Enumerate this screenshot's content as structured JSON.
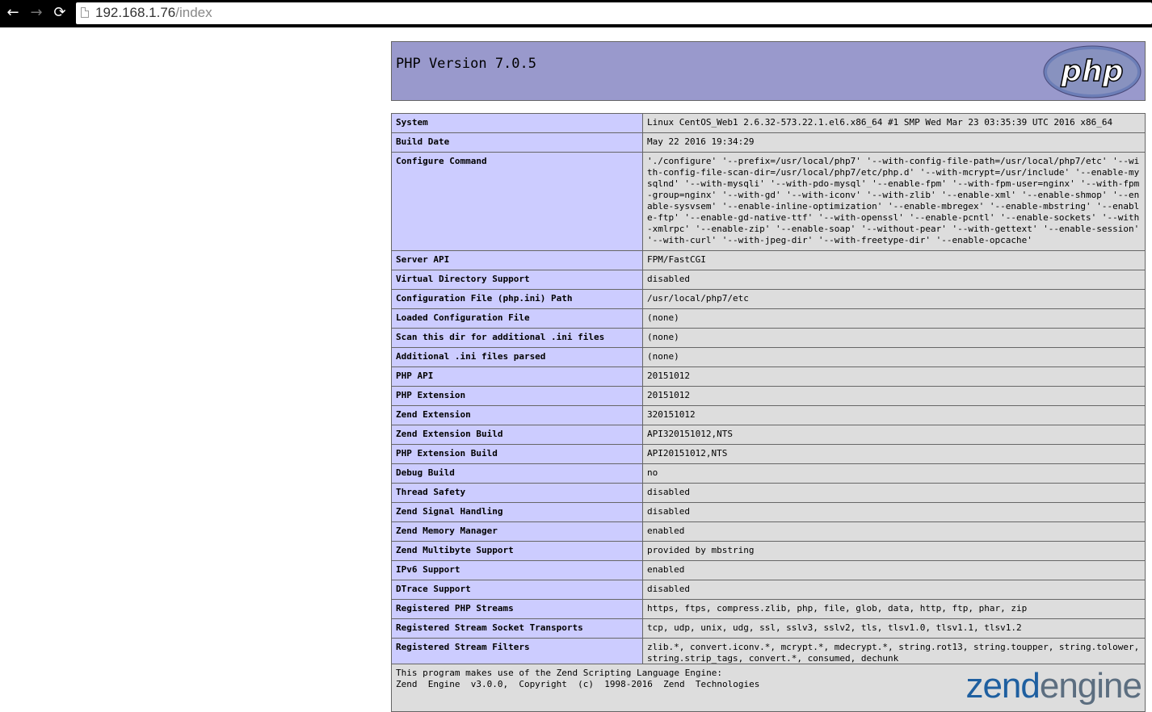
{
  "browser": {
    "url_host": "192.168.1.76",
    "url_path": "/index",
    "back_icon": "←",
    "forward_icon": "→",
    "reload_icon": "⟳"
  },
  "header": {
    "title": "PHP Version 7.0.5",
    "logo_text": "php"
  },
  "rows": [
    {
      "key": "System",
      "value": "Linux CentOS_Web1 2.6.32-573.22.1.el6.x86_64 #1 SMP Wed Mar 23 03:35:39 UTC 2016 x86_64"
    },
    {
      "key": "Build Date",
      "value": "May 22 2016 19:34:29"
    },
    {
      "key": "Configure Command",
      "value": "'./configure' '--prefix=/usr/local/php7' '--with-config-file-path=/usr/local/php7/etc' '--with-config-file-scan-dir=/usr/local/php7/etc/php.d' '--with-mcrypt=/usr/include' '--enable-mysqlnd' '--with-mysqli' '--with-pdo-mysql' '--enable-fpm' '--with-fpm-user=nginx' '--with-fpm-group=nginx' '--with-gd' '--with-iconv' '--with-zlib' '--enable-xml' '--enable-shmop' '--enable-sysvsem' '--enable-inline-optimization' '--enable-mbregex' '--enable-mbstring' '--enable-ftp' '--enable-gd-native-ttf' '--with-openssl' '--enable-pcntl' '--enable-sockets' '--with-xmlrpc' '--enable-zip' '--enable-soap' '--without-pear' '--with-gettext' '--enable-session' '--with-curl' '--with-jpeg-dir' '--with-freetype-dir' '--enable-opcache'"
    },
    {
      "key": "Server API",
      "value": "FPM/FastCGI"
    },
    {
      "key": "Virtual Directory Support",
      "value": "disabled"
    },
    {
      "key": "Configuration File (php.ini) Path",
      "value": "/usr/local/php7/etc"
    },
    {
      "key": "Loaded Configuration File",
      "value": "(none)"
    },
    {
      "key": "Scan this dir for additional .ini files",
      "value": "(none)"
    },
    {
      "key": "Additional .ini files parsed",
      "value": "(none)"
    },
    {
      "key": "PHP API",
      "value": "20151012"
    },
    {
      "key": "PHP Extension",
      "value": "20151012"
    },
    {
      "key": "Zend Extension",
      "value": "320151012"
    },
    {
      "key": "Zend Extension Build",
      "value": "API320151012,NTS"
    },
    {
      "key": "PHP Extension Build",
      "value": "API20151012,NTS"
    },
    {
      "key": "Debug Build",
      "value": "no"
    },
    {
      "key": "Thread Safety",
      "value": "disabled"
    },
    {
      "key": "Zend Signal Handling",
      "value": "disabled"
    },
    {
      "key": "Zend Memory Manager",
      "value": "enabled"
    },
    {
      "key": "Zend Multibyte Support",
      "value": "provided by mbstring"
    },
    {
      "key": "IPv6 Support",
      "value": "enabled"
    },
    {
      "key": "DTrace Support",
      "value": "disabled"
    },
    {
      "key": "Registered PHP Streams",
      "value": "https, ftps, compress.zlib, php, file, glob, data, http, ftp, phar, zip"
    },
    {
      "key": "Registered Stream Socket Transports",
      "value": "tcp, udp, unix, udg, ssl, sslv3, sslv2, tls, tlsv1.0, tlsv1.1, tlsv1.2"
    },
    {
      "key": "Registered Stream Filters",
      "value": "zlib.*, convert.iconv.*, mcrypt.*, mdecrypt.*, string.rot13, string.toupper, string.tolower, string.strip_tags, convert.*, consumed, dechunk"
    }
  ],
  "footer": {
    "line1": "This program makes use of the Zend Scripting Language Engine:",
    "line2": "Zend  Engine  v3.0.0,  Copyright  (c)  1998-2016  Zend  Technologies",
    "logo_zend": "zend",
    "logo_engine": "engine"
  }
}
